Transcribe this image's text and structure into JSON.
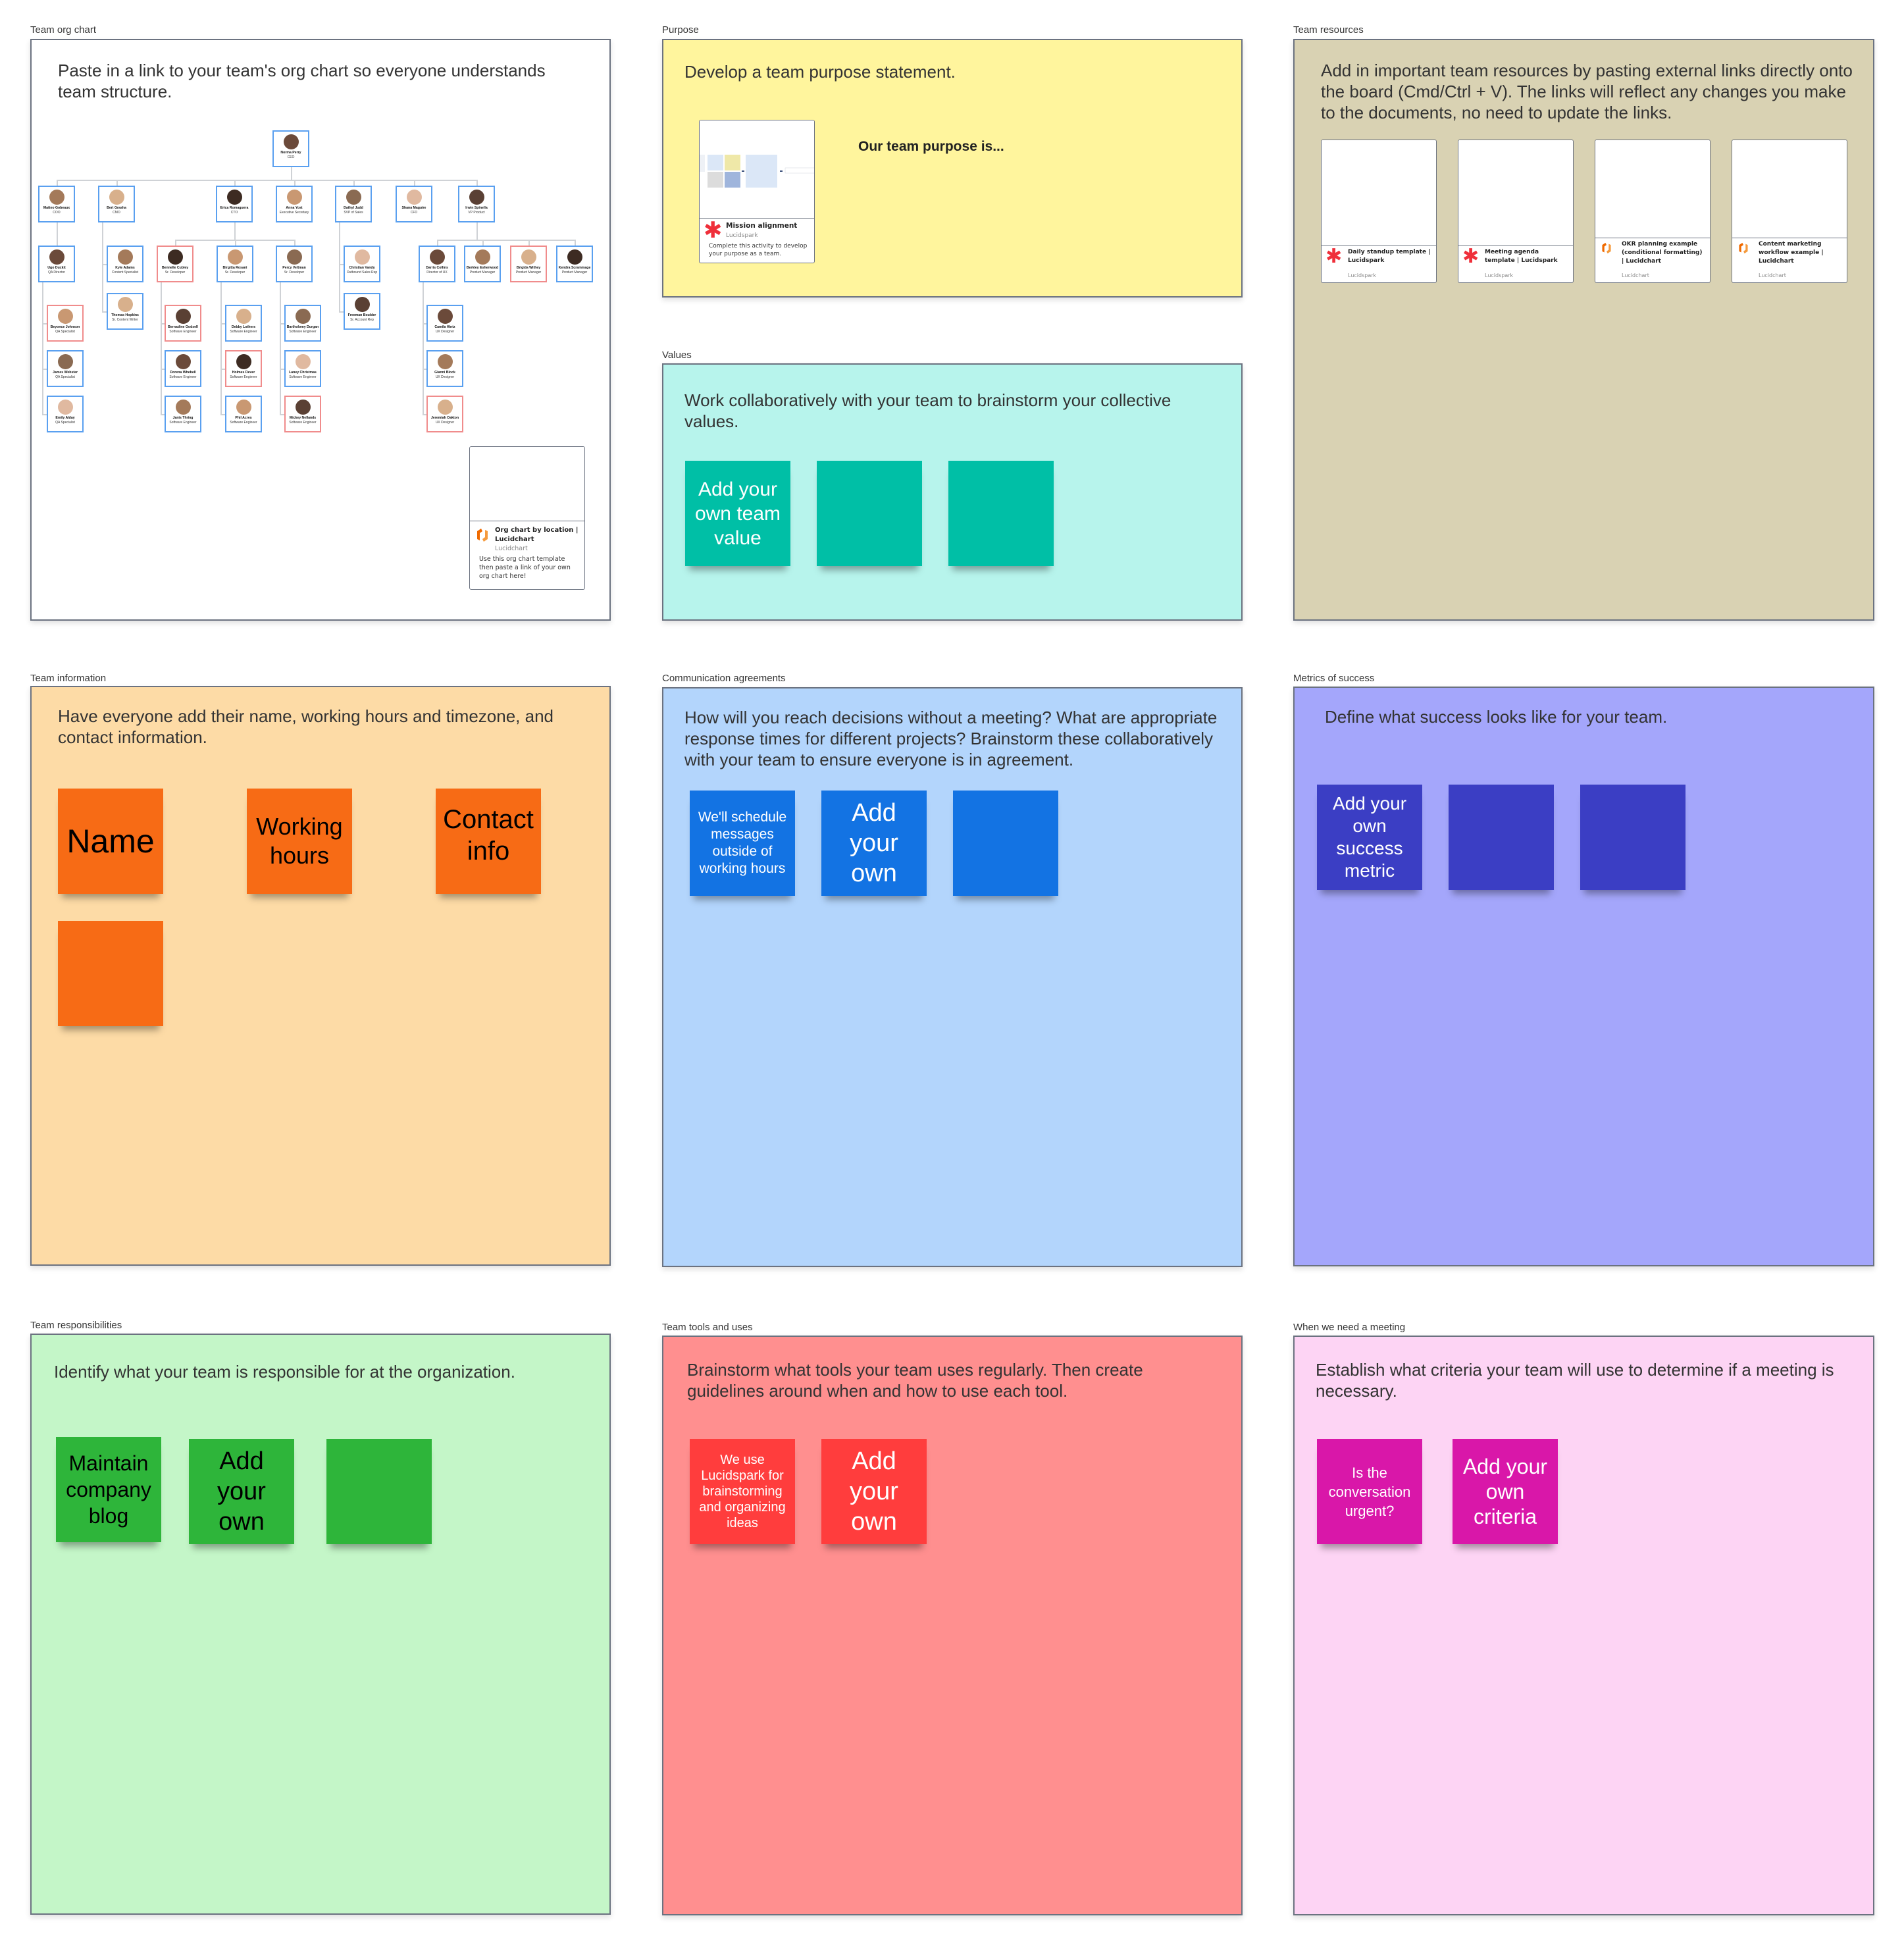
{
  "colors": {
    "org_frame": "#ffffff",
    "purpose_frame": "#fff59d",
    "resources_frame": "#d9d2b3",
    "values_frame": "#b7f4ec",
    "values_sticky": "#00bfa6",
    "info_frame": "#fddba6",
    "info_sticky": "#f76b15",
    "comm_frame": "#b3d5fc",
    "comm_sticky": "#1373e3",
    "metrics_frame": "#a4a6fb",
    "metrics_sticky": "#3b3ec4",
    "resp_frame": "#c4f6c8",
    "resp_sticky": "#2eb53a",
    "tools_frame": "#ff8f8f",
    "tools_sticky": "#ff3d3d",
    "meeting_frame": "#fdd4f4",
    "meeting_sticky": "#d917a9",
    "lucidspark_brand": "#ef2f3a",
    "lucidchart_brand": "#f06a00",
    "node_border_blue": "#5aa0f0",
    "node_border_red": "#f08c8c"
  },
  "frames": {
    "org_chart": {
      "label": "Team org chart",
      "prompt": "Paste in a link to your team's org chart so everyone understands team structure.",
      "link_card": {
        "icon": "lucidchart-logo-icon",
        "title": "Org chart by location | Lucidchart",
        "source": "Lucidchart",
        "description": "Use this org chart template then paste a link of your own org chart here!"
      },
      "nodes": [
        {
          "name": "Norma Perry",
          "role": "CEO",
          "highlight": false
        },
        {
          "name": "Matteo Gobeaux",
          "role": "COO",
          "highlight": false
        },
        {
          "name": "Bert Grasha",
          "role": "CMO",
          "highlight": false
        },
        {
          "name": "Erica Romaguera",
          "role": "CTO",
          "highlight": false
        },
        {
          "name": "Anna Yost",
          "role": "Executive Secretary",
          "highlight": false
        },
        {
          "name": "Dathyl Judd",
          "role": "SVP of Sales",
          "highlight": false
        },
        {
          "name": "Shana Maguire",
          "role": "CFO",
          "highlight": false
        },
        {
          "name": "Irwin Spinella",
          "role": "VP Product",
          "highlight": false
        },
        {
          "name": "Ugo Duckit",
          "role": "QA Director",
          "highlight": false
        },
        {
          "name": "Kyle Adams",
          "role": "Content Specialist",
          "highlight": false
        },
        {
          "name": "Thomas Hopkins",
          "role": "Sr. Content Writer",
          "highlight": false
        },
        {
          "name": "Bennelle Cubley",
          "role": "Sr. Developer",
          "highlight": true
        },
        {
          "name": "Birgitta Rosani",
          "role": "Sr. Developer",
          "highlight": false
        },
        {
          "name": "Percy Veltman",
          "role": "Sr. Developer",
          "highlight": false
        },
        {
          "name": "Christian Vandy",
          "role": "Outbound Sales Rep",
          "highlight": false
        },
        {
          "name": "Freeman Boulder",
          "role": "Sr. Account Rep",
          "highlight": false
        },
        {
          "name": "Darris Collins",
          "role": "Director of UX",
          "highlight": false
        },
        {
          "name": "Berkley Esherwood",
          "role": "Product Manager",
          "highlight": false
        },
        {
          "name": "Brigida Withey",
          "role": "Product Manager",
          "highlight": true
        },
        {
          "name": "Kendra Scrammage",
          "role": "Product Manager",
          "highlight": false
        },
        {
          "name": "Beyonce Johnson",
          "role": "QA Specialist",
          "highlight": true
        },
        {
          "name": "James Webster",
          "role": "QA Specialist",
          "highlight": false
        },
        {
          "name": "Emily Alday",
          "role": "QA Specialist",
          "highlight": false
        },
        {
          "name": "Bernadine Godsell",
          "role": "Software Engineer",
          "highlight": true
        },
        {
          "name": "Dorena Whebell",
          "role": "Software Engineer",
          "highlight": false
        },
        {
          "name": "Janis Thring",
          "role": "Software Engineer",
          "highlight": false
        },
        {
          "name": "Debby Lothers",
          "role": "Software Engineer",
          "highlight": false
        },
        {
          "name": "Holmes Dever",
          "role": "Software Engineer",
          "highlight": true
        },
        {
          "name": "Phil Acres",
          "role": "Software Engineer",
          "highlight": false
        },
        {
          "name": "Bartholomy Durgan",
          "role": "Software Engineer",
          "highlight": false
        },
        {
          "name": "Laney Christmas",
          "role": "Software Engineer",
          "highlight": false
        },
        {
          "name": "Mickey Nellands",
          "role": "Software Engineer",
          "highlight": true
        },
        {
          "name": "Camila Hintz",
          "role": "UX Designer",
          "highlight": false
        },
        {
          "name": "Gianni Block",
          "role": "UX Designer",
          "highlight": false
        },
        {
          "name": "Jeremiah Oakton",
          "role": "UX Designer",
          "highlight": true
        }
      ]
    },
    "purpose": {
      "label": "Purpose",
      "prompt": "Develop a team purpose statement.",
      "statement_heading": "Our team purpose is...",
      "link_card": {
        "icon": "lucidspark-logo-icon",
        "title": "Mission alignment",
        "source": "Lucidspark",
        "description": "Complete this activity to develop your purpose as a team."
      }
    },
    "resources": {
      "label": "Team resources",
      "prompt": "Add in important team resources by pasting external links directly onto the board (Cmd/Ctrl + V). The links will reflect any changes you make to the documents, no need to update the links.",
      "link_cards": [
        {
          "icon": "lucidspark-logo-icon",
          "title": "Daily standup template | Lucidspark",
          "source": "Lucidspark"
        },
        {
          "icon": "lucidspark-logo-icon",
          "title": "Meeting agenda template | Lucidspark",
          "source": "Lucidspark"
        },
        {
          "icon": "lucidchart-logo-icon",
          "title": "OKR planning example (conditional formatting) | Lucidchart",
          "source": "Lucidchart"
        },
        {
          "icon": "lucidchart-logo-icon",
          "title": "Content marketing workflow example | Lucidchart",
          "source": "Lucidchart"
        }
      ]
    },
    "values": {
      "label": "Values",
      "prompt": "Work collaboratively with your team to brainstorm your collective values.",
      "stickies": [
        "Add your own team value",
        "",
        ""
      ]
    },
    "team_info": {
      "label": "Team information",
      "prompt": "Have everyone add their name, working hours and timezone, and contact information.",
      "stickies": [
        "Name",
        "Working hours",
        "Contact info",
        ""
      ]
    },
    "communication": {
      "label": "Communication agreements",
      "prompt": "How will you reach decisions without a meeting? What are appropriate response times for different projects? Brainstorm these collaboratively with your team to ensure everyone is in agreement.",
      "stickies": [
        "We'll schedule messages outside of working hours",
        "Add your own",
        ""
      ]
    },
    "metrics": {
      "label": "Metrics of success",
      "prompt": "Define what success looks like for your team.",
      "stickies": [
        "Add your own success metric",
        "",
        ""
      ]
    },
    "responsibilities": {
      "label": "Team responsibilities",
      "prompt": "Identify what your team is responsible for at the organization.",
      "stickies": [
        "Maintain company blog",
        "Add your own",
        ""
      ]
    },
    "tools": {
      "label": "Team tools and uses",
      "prompt": "Brainstorm what tools your team uses regularly. Then create guidelines around when and how to use each tool.",
      "stickies": [
        "We use Lucidspark for brainstorming and organizing ideas",
        "Add your own"
      ]
    },
    "meeting": {
      "label": "When we need a meeting",
      "prompt": "Establish what criteria your team will use to determine if a meeting is necessary.",
      "stickies": [
        "Is the conversation urgent?",
        "Add your own criteria"
      ]
    }
  }
}
